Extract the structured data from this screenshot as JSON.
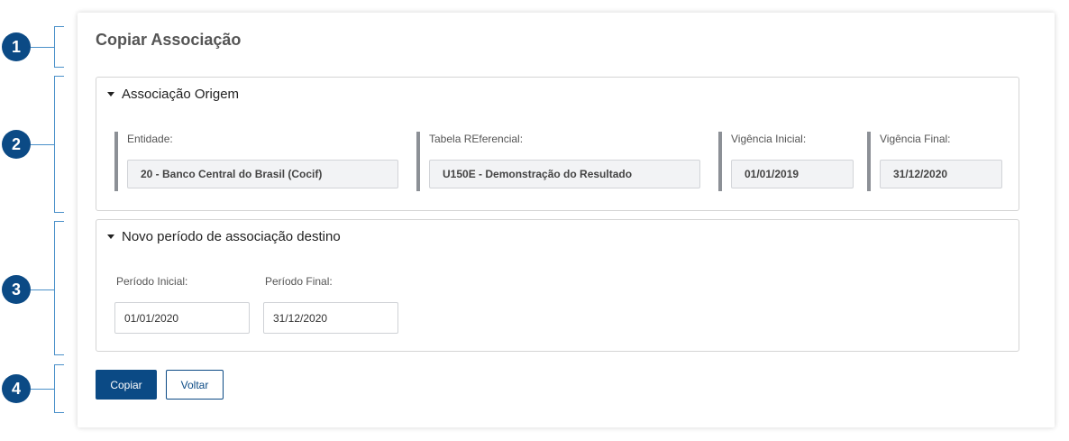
{
  "annotations": {
    "markers": [
      "1",
      "2",
      "3",
      "4"
    ]
  },
  "card": {
    "title": "Copiar Associação"
  },
  "origin_panel": {
    "header": "Associação Origem",
    "fields": [
      {
        "label": "Entidade:",
        "value": "20 - Banco Central do Brasil (Cocif)"
      },
      {
        "label": "Tabela REferencial:",
        "value": "U150E - Demonstração do Resultado"
      },
      {
        "label": "Vigência Inicial:",
        "value": "01/01/2019"
      },
      {
        "label": "Vigência Final:",
        "value": "31/12/2020"
      }
    ]
  },
  "destination_panel": {
    "header": "Novo período de associação destino",
    "start_label": "Período Inicial:",
    "start_value": "01/01/2020",
    "end_label": "Período Final:",
    "end_value": "31/12/2020"
  },
  "actions": {
    "copy_label": "Copiar",
    "back_label": "Voltar"
  },
  "colors": {
    "primary": "#0b4a85",
    "annotation_line": "#4a90c9"
  }
}
